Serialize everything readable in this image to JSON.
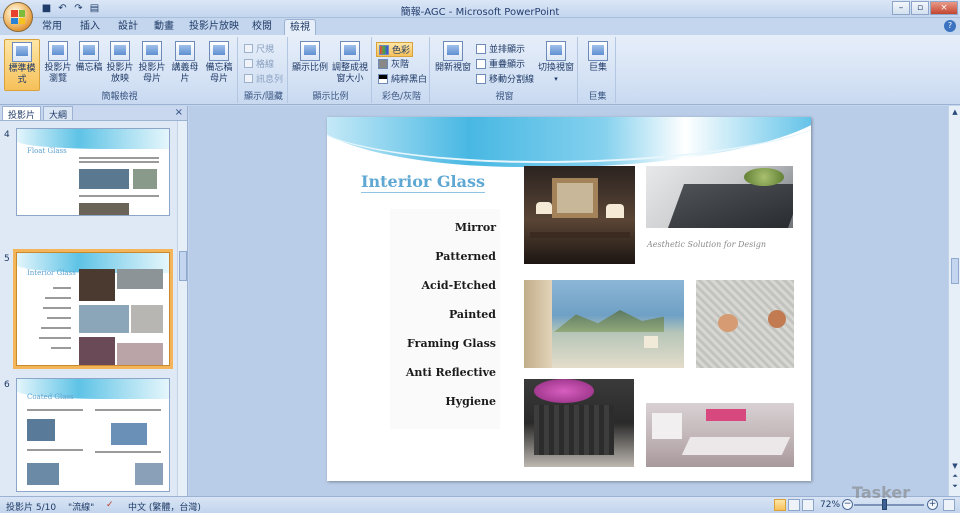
{
  "window": {
    "title": "簡報-AGC - Microsoft PowerPoint",
    "buttons": [
      "–",
      "▫",
      "×"
    ],
    "sub_buttons": [
      "–",
      "▫",
      "×"
    ]
  },
  "qat": {
    "icons": [
      "save-icon",
      "undo-icon",
      "redo-icon",
      "print-icon"
    ]
  },
  "tabs": [
    {
      "label": "常用"
    },
    {
      "label": "插入"
    },
    {
      "label": "設計"
    },
    {
      "label": "動畫"
    },
    {
      "label": "投影片放映"
    },
    {
      "label": "校閱"
    },
    {
      "label": "檢視"
    }
  ],
  "ribbon": {
    "help_glyph": "?",
    "group_presentation_views": {
      "label": "簡報檢視",
      "buttons": [
        "標準模式",
        "投影片瀏覽",
        "備忘稿",
        "投影片放映",
        "投影片母片",
        "講義母片",
        "備忘稿母片"
      ]
    },
    "group_show_hide": {
      "label": "顯示/隱藏",
      "checks": [
        "尺規",
        "格線",
        "訊息列"
      ]
    },
    "group_zoom": {
      "label": "顯示比例",
      "buttons": [
        "顯示比例",
        "調整成視窗大小"
      ]
    },
    "group_color": {
      "label": "彩色/灰階",
      "buttons": [
        "色彩",
        "灰階",
        "純粹黑白"
      ]
    },
    "group_window": {
      "label": "視窗",
      "buttons": [
        "開新視窗",
        "並排顯示",
        "重疊顯示",
        "移動分割線",
        "切換視窗"
      ]
    },
    "group_macro": {
      "label": "巨集",
      "buttons": [
        "巨集"
      ]
    }
  },
  "left_panel": {
    "tabs": [
      "投影片",
      "大綱"
    ],
    "close_glyph": "×",
    "thumbnails": [
      {
        "number": "4",
        "title": "Float Glass"
      },
      {
        "number": "5",
        "title": "Interior Glass",
        "selected": true
      },
      {
        "number": "6",
        "title": "Coated Glass"
      }
    ]
  },
  "slide": {
    "title": "Interior Glass",
    "items": [
      "Mirror",
      "Patterned",
      "Acid-Etched",
      "Painted",
      "Framing Glass",
      "Anti Reflective",
      "Hygiene"
    ],
    "caption": "Aesthetic Solution for Design"
  },
  "status": {
    "slide_info": "投影片 5/10",
    "theme": "\"流線\"",
    "language": "中文 (繁體，台灣)",
    "zoom": "72%"
  },
  "watermark": "Tasker"
}
